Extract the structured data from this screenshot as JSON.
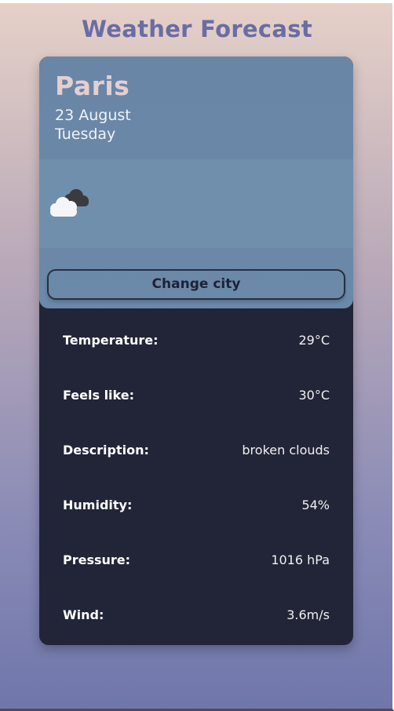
{
  "header": {
    "title": "Weather Forecast"
  },
  "location": {
    "city": "Paris",
    "date": "23 August",
    "weekday": "Tuesday"
  },
  "weather": {
    "icon": "broken-clouds-icon"
  },
  "actions": {
    "change_city_label": "Change city"
  },
  "details": [
    {
      "label": "Temperature:",
      "value": "29°C"
    },
    {
      "label": "Feels like:",
      "value": "30°C"
    },
    {
      "label": "Description:",
      "value": "broken clouds"
    },
    {
      "label": "Humidity:",
      "value": "54%"
    },
    {
      "label": "Pressure:",
      "value": "1016 hPa"
    },
    {
      "label": "Wind:",
      "value": "3.6m/s"
    }
  ],
  "colors": {
    "title": "#6a6da3",
    "card_top": "#6a86a7",
    "card_bottom": "#222537",
    "city": "#e4cfd0"
  }
}
